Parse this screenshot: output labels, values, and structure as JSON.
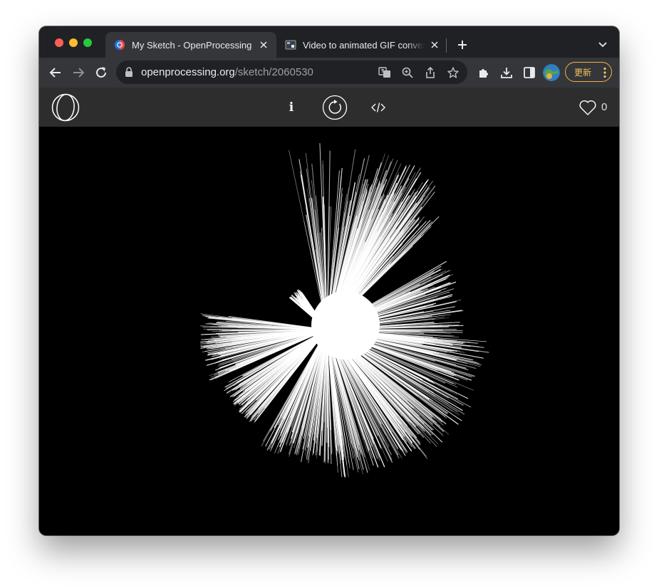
{
  "browser": {
    "tabs": [
      {
        "title": "My Sketch - OpenProcessing",
        "favicon": "openprocessing-favicon",
        "active": true
      },
      {
        "title": "Video to animated GIF converter",
        "favicon": "gif-converter-favicon",
        "active": false
      }
    ],
    "address": {
      "domain": "openprocessing.org",
      "path": "/sketch/2060530"
    },
    "update_label": "更新"
  },
  "sketch_page": {
    "logo": "openprocessing-logo",
    "buttons": [
      "info-icon",
      "restart-icon",
      "code-icon"
    ],
    "info_label": "i",
    "like_count": "0"
  },
  "colors": {
    "tab_strip": "#202124",
    "toolbar": "#35363a",
    "omnibox": "#202124",
    "header": "#2d2d2d",
    "canvas": "#000000",
    "strokes": "#ffffff",
    "update_accent": "#f0b443"
  }
}
